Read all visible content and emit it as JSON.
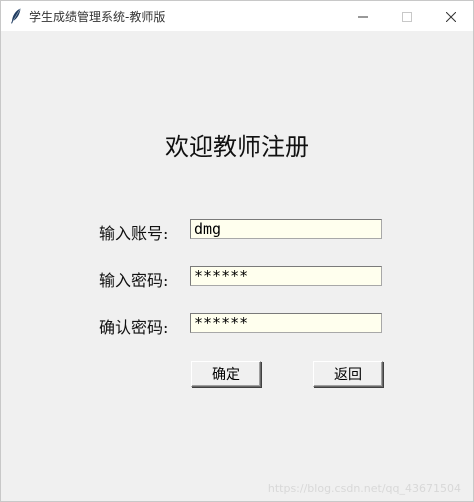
{
  "window": {
    "title": "学生成绩管理系统-教师版",
    "icon": "feather-icon",
    "controls": {
      "minimize": "minimize-icon",
      "maximize": "maximize-icon",
      "close": "close-icon"
    }
  },
  "main": {
    "heading": "欢迎教师注册",
    "fields": [
      {
        "label": "输入账号:",
        "value": "dmg"
      },
      {
        "label": "输入密码:",
        "value": "******"
      },
      {
        "label": "确认密码:",
        "value": "******"
      }
    ],
    "buttons": {
      "confirm_label": "确定",
      "back_label": "返回"
    }
  },
  "watermark": "https://blog.csdn.net/qq_43671504",
  "colors": {
    "background": "#f0f0f0",
    "field_background": "#ffffee",
    "titlebar": "#ffffff"
  }
}
